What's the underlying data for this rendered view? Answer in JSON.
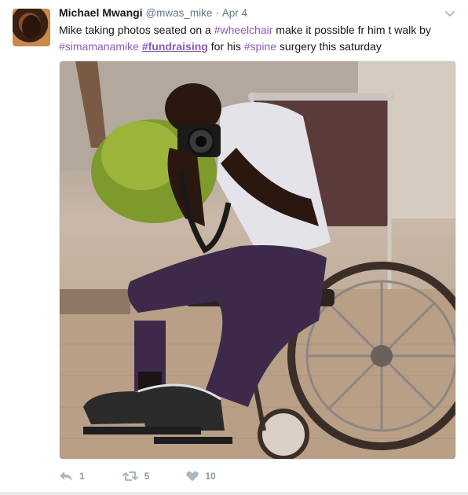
{
  "tweet": {
    "author_name": "Michael Mwangi",
    "author_handle": "@mwas_mike",
    "separator": "·",
    "date": "Apr 4",
    "text_parts": {
      "p1": "Mike taking photos seated on a ",
      "tag1": "#wheelchair",
      "p2": " make it possible fr him t walk by",
      "tag2": "#simamanamike",
      "tag3": "#fundraising",
      "p3": " for his ",
      "tag4": "#spine",
      "p4": " surgery this saturday"
    }
  },
  "actions": {
    "reply_count": "1",
    "retweet_count": "5",
    "like_count": "10"
  },
  "colors": {
    "hashtag": "#8a5bb8",
    "meta": "#657786",
    "action": "#8899a6"
  }
}
